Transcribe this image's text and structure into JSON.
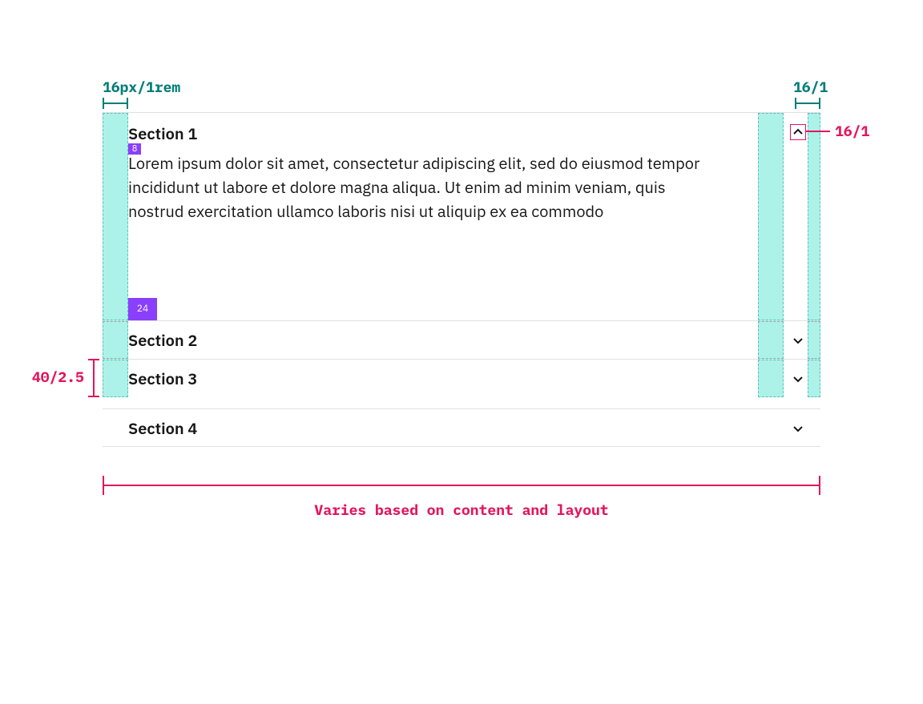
{
  "dimensions": {
    "gutter_left_label": "16px/1rem",
    "gutter_right_label": "16/1",
    "chevron_label": "16/1",
    "row_height_label": "40/2.5",
    "width_note": "Varies based on content and layout"
  },
  "spacing_tokens": {
    "title_body_gap": "8",
    "panel_bottom": "24"
  },
  "sections": [
    {
      "title": "Section 1",
      "expanded": true,
      "body": "Lorem ipsum dolor sit amet, consectetur adipiscing elit, sed do eiusmod tempor incididunt ut labore et dolore magna aliqua. Ut enim ad minim veniam, quis nostrud exercitation ullamco laboris nisi ut aliquip ex ea commodo"
    },
    {
      "title": "Section 2",
      "expanded": false
    },
    {
      "title": "Section 3",
      "expanded": false
    },
    {
      "title": "Section 4",
      "expanded": false
    }
  ],
  "colors": {
    "teal_overlay": "#67e8d7",
    "teal_label": "#007d79",
    "magenta": "#e3165b",
    "purple": "#8a3ffc",
    "ink": "#161616"
  }
}
